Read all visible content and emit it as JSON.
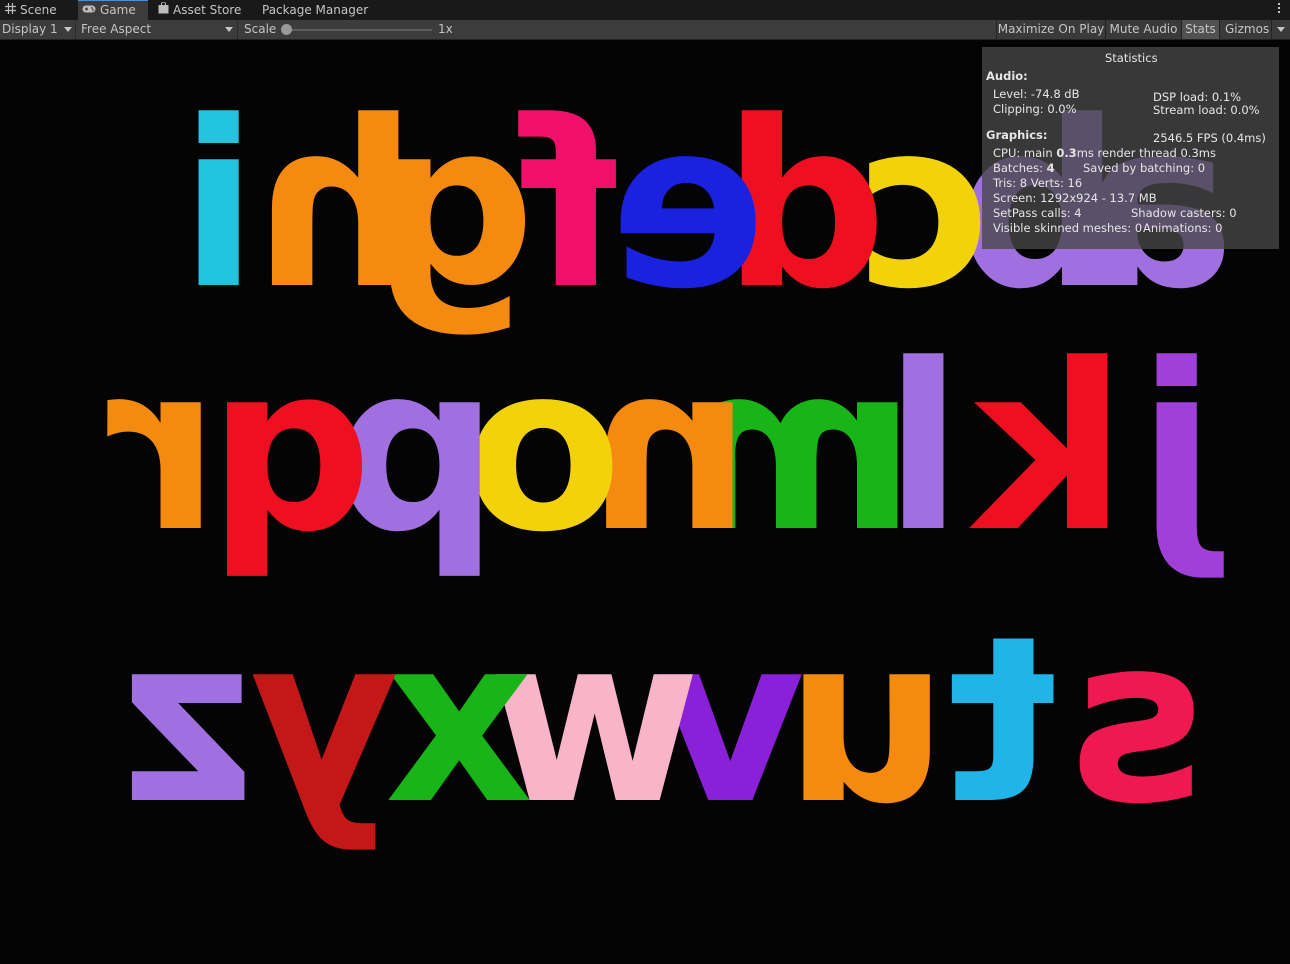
{
  "tabs": [
    {
      "label": "Scene",
      "icon": "grid-icon"
    },
    {
      "label": "Game",
      "icon": "gamepad-icon",
      "active": true
    },
    {
      "label": "Asset Store",
      "icon": "shopping-bag-icon"
    },
    {
      "label": "Package Manager",
      "icon": "package-icon"
    }
  ],
  "toolbar": {
    "display": "Display 1",
    "aspect": "Free Aspect",
    "scale_label": "Scale",
    "scale_value": "1x",
    "scale_slider_fraction": 0.0,
    "buttons": {
      "maximize": "Maximize On Play",
      "mute": "Mute Audio",
      "stats": "Stats",
      "gizmos": "Gizmos"
    }
  },
  "stats": {
    "title": "Statistics",
    "audio_header": "Audio:",
    "level": "Level: -74.8 dB",
    "clipping": "Clipping: 0.0%",
    "dsp_load": "DSP load: 0.1%",
    "stream_load": "Stream load: 0.0%",
    "graphics_header": "Graphics:",
    "fps": "2546.5 FPS (0.4ms)",
    "cpu_prefix": "CPU: main ",
    "cpu_main": "0.3",
    "cpu_suffix": "ms  render thread 0.3ms",
    "batches_prefix": "Batches: ",
    "batches": "4",
    "saved_by_batching": "Saved by batching: 0",
    "tris_verts": "Tris: 8   Verts: 16",
    "screen": "Screen: 1292x924 - 13.7 MB",
    "setpass": "SetPass calls: 4",
    "shadow_casters": "Shadow casters: 0",
    "skinned": "Visible skinned meshes: 0",
    "animations": "Animations: 0"
  },
  "scene": {
    "rows": [
      "abcdefghi",
      "jklmnopqr",
      "stuvwxyz"
    ],
    "colors": {
      "a": "#a070e0",
      "b": "#a070e0",
      "c": "#f2d20a",
      "d": "#ee1020",
      "e": "#1a22e0",
      "f": "#f0106a",
      "g": "#f58a10",
      "h": "#f58a10",
      "i": "#20c4dc",
      "j": "#a040d8",
      "k": "#ee1020",
      "l": "#a070e0",
      "m": "#18b418",
      "n": "#f58a10",
      "o": "#f2d20a",
      "p": "#a070e0",
      "q": "#ee1020",
      "r": "#f58a10",
      "s": "#f01850",
      "t": "#20b4e8",
      "u": "#f58a10",
      "v": "#8a20d8",
      "w": "#f8b4c8",
      "x": "#18b418",
      "y": "#c41818",
      "z": "#a070e0"
    }
  }
}
